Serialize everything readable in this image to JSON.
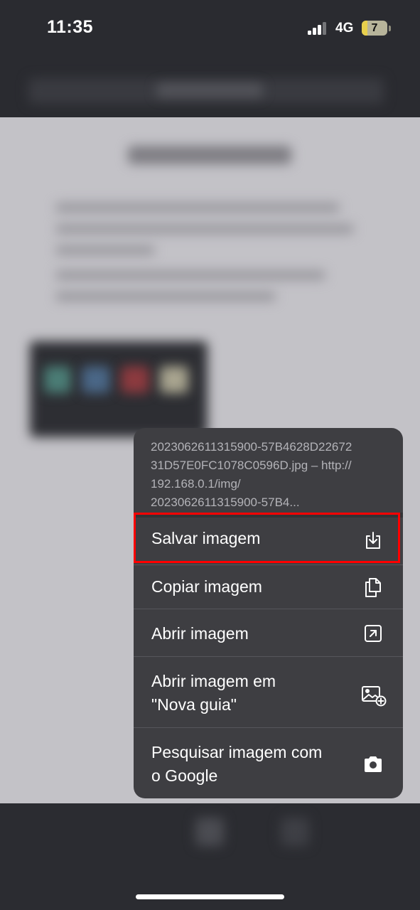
{
  "status_bar": {
    "time": "11:35",
    "network": "4G",
    "battery_level": "7",
    "signal_bars_active": 3
  },
  "context_menu": {
    "header_lines": [
      "2023062611315900-57B4628D22672",
      "31D57E0FC1078C0596D.jpg – http://",
      "192.168.0.1/img/",
      "2023062611315900-57B4..."
    ],
    "items": [
      {
        "label": "Salvar imagem",
        "icon": "save-download-icon",
        "highlighted": true
      },
      {
        "label": "Copiar imagem",
        "icon": "copy-documents-icon"
      },
      {
        "label": "Abrir imagem",
        "icon": "open-external-arrow-icon"
      },
      {
        "label_lines": [
          "Abrir imagem em",
          "\"Nova guia\""
        ],
        "icon": "image-add-icon"
      },
      {
        "label_lines": [
          "Pesquisar imagem com",
          "o Google"
        ],
        "icon": "camera-lens-icon"
      }
    ]
  },
  "colors": {
    "menu_background": "#3e3e42",
    "highlight_border": "#ff0000",
    "status_text": "#ffffff"
  }
}
